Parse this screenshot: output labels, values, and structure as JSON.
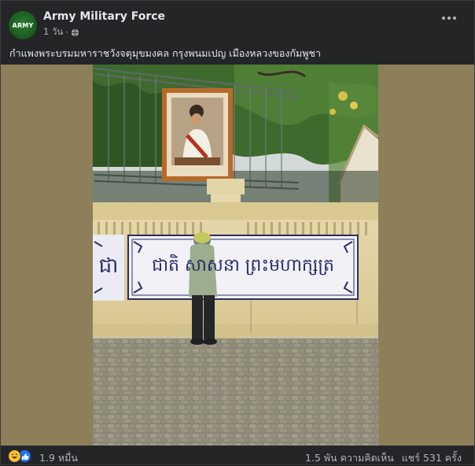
{
  "post": {
    "page_name": "Army Military Force",
    "avatar_text": "ARMY",
    "timestamp": "1 วัน",
    "privacy_icon": "globe-icon",
    "caption": "กำแพงพระบรมมหาราชวังจตุมุขมงคล กรุงพนมเปญ เมืองหลวงของกัมพูชา",
    "more_icon": "more-horizontal-icon"
  },
  "photo": {
    "banner_text": "ជាតិ សាសនា ព្រះមហាក្សត្រ",
    "banner_left_fragment": "ជា"
  },
  "footer": {
    "reactions": [
      "haha-icon",
      "like-icon"
    ],
    "reaction_count": "1.9 หมื่น",
    "comments": "1.5 พัน ความคิดเห็น",
    "shares": "แชร์ 531 ครั้ง"
  },
  "colors": {
    "background": "#242526",
    "text_primary": "#e4e6eb",
    "text_secondary": "#b0b3b8",
    "side_panel": "#8c7f5a",
    "like_blue": "#1877f2",
    "haha_yellow": "#f7c233"
  }
}
